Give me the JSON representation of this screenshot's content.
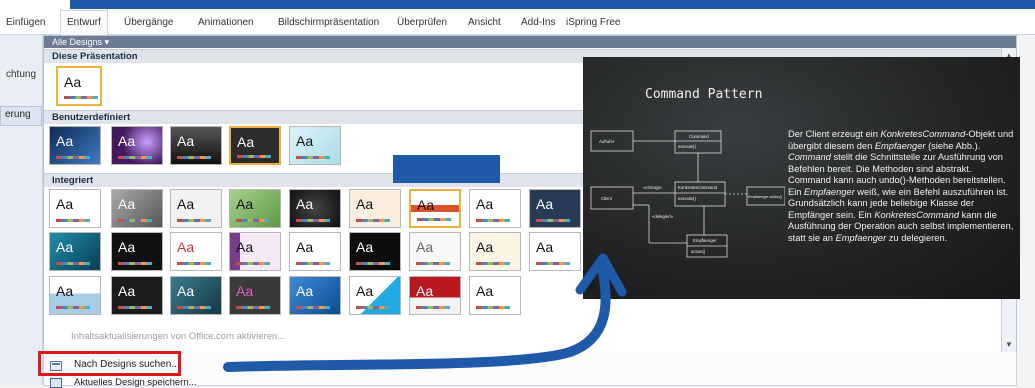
{
  "ribbon": {
    "tabs": [
      "Einfügen",
      "Entwurf",
      "Übergänge",
      "Animationen",
      "Bildschirmpräsentation",
      "Überprüfen",
      "Ansicht",
      "Add-Ins",
      "iSpring Free"
    ],
    "active_tab": "Entwurf"
  },
  "left_pane": {
    "label1": "chtung",
    "label2": "erung"
  },
  "gallery": {
    "filter_label": "Alle Designs ▾",
    "sections": {
      "this": "Diese Präsentation",
      "custom": "Benutzerdefiniert",
      "builtin": "Integriert"
    },
    "thumb_label": "Aa"
  },
  "menu": {
    "office_update": "Inhaltsaktualisierungen von Office.com aktivieren...",
    "search": "Nach Designs suchen...",
    "save": "Aktuelles Design speichern..."
  },
  "slide": {
    "title": "Command Pattern",
    "uml": {
      "aufrufer": "Aufrufer",
      "command": "Command",
      "execute": "execute()",
      "client": "Client",
      "konkretes": "KonkretesCommand",
      "execute2": "execute()",
      "erzeugt": "«erzeugt»",
      "delegiert": "«delegiert»",
      "empf_action": "Empfaenger.action()",
      "empfaenger": "Empfaenger",
      "action": "action()"
    },
    "text_parts": [
      "Der Client erzeugt ein ",
      "KonkretesCommand",
      "-Objekt und übergibt diesem den ",
      "Empfaenger",
      " (siehe Abb.). ",
      "Command",
      " stellt die Schnittstelle zur Ausführung von Befehlen bereit. Die Methoden sind abstrakt. Command kann auch undo()-Methoden bereitstellen. Ein ",
      "Empfaenger",
      " weiß, wie ein Befehl auszuführen ist. Grundsätzlich kann jede beliebige Klasse der Empfänger sein. Ein ",
      "KonkretesCommand",
      " kann die Ausführung der Operation auch selbst implementieren, statt sie an ",
      "Empfaenger",
      " zu delegieren."
    ]
  },
  "colors": {
    "annotation_blue": "#1f5aa8",
    "highlight_red": "#e0161d",
    "selection": "#f0b13c"
  }
}
